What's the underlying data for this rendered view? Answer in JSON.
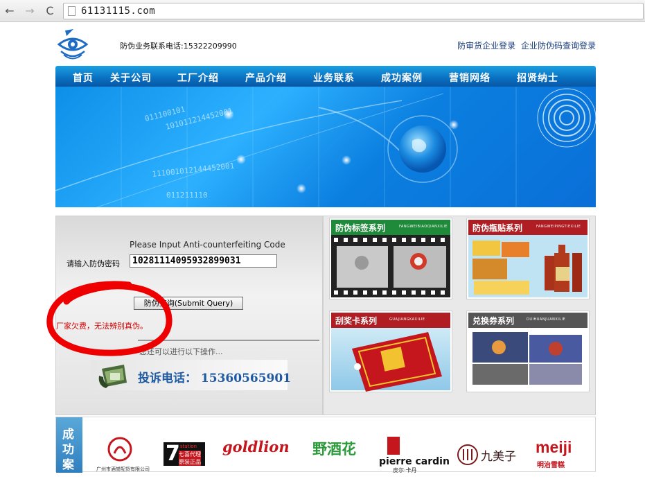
{
  "browser": {
    "url": "61131115.com",
    "back_glyph": "←",
    "forward_glyph": "→",
    "reload_glyph": "C"
  },
  "header": {
    "hotline": "防伪业务联系电话:15322209990",
    "links": [
      "防审货企业登录",
      "企业防伪码查询登录"
    ]
  },
  "menu": {
    "items": [
      "首页",
      "关于公司",
      "工厂介绍",
      "产品介绍",
      "业务联系",
      "成功案例",
      "营销网络",
      "招贤纳士"
    ]
  },
  "banner": {
    "digits_1": "011100101",
    "digits_2": "101011214452001",
    "digits_3": "111001012144452001",
    "digits_4": "011211110"
  },
  "query": {
    "title": "Please Input Anti-counterfeiting Code",
    "label": "请输入防伪密码",
    "value": "10281114095932899031",
    "button": "防伪查询(Submit Query)",
    "error": "厂家欠费，无法辨别真伪。",
    "hint": "您还可以进行以下操作...",
    "complaint": "投诉电话：  15360565901"
  },
  "products": [
    {
      "title": "防伪标签系列",
      "sub": "FANGWEIBIAOQIANXILIE",
      "head_color": "#1f8a3a"
    },
    {
      "title": "防伪瓶贴系列",
      "sub": "FANGWEIPINGTIEXILIE",
      "head_color": "#b01e24"
    },
    {
      "title": "刮奖卡系列",
      "sub": "GUAJIANGKAXILIE",
      "head_color": "#b01e24"
    },
    {
      "title": "兑换券系列",
      "sub": "DUIHUANJUANXILIE",
      "head_color": "#555555"
    }
  ],
  "brands": {
    "side_text": "成功案例",
    "caption_1": "广州市酒誉配货有限公司",
    "names": [
      "goldlion",
      "野酒花",
      "pierre cardin",
      "皮尔·卡丹",
      "九美子",
      "meiji",
      "明治雪糕"
    ],
    "seven_top": "station",
    "seven_mid": "七喜代理",
    "seven_bot": "原装正品"
  },
  "colors": {
    "menu_blue": "#0a6fc0",
    "error_red": "#d40000",
    "complaint_blue": "#1f5aa3",
    "annotation_red": "#ee0000"
  }
}
